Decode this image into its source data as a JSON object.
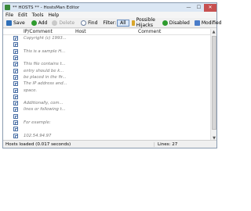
{
  "titlebar": {
    "title": "** HOSTS ** - HostsMan Editor",
    "minimize_glyph": "—",
    "maximize_glyph": "☐",
    "close_glyph": "✕"
  },
  "menubar": {
    "items": [
      "File",
      "Edit",
      "Tools",
      "Help"
    ]
  },
  "toolbar": {
    "save": "Save",
    "add": "Add",
    "delete": "Delete",
    "find": "Find",
    "filter_label": "Filter:",
    "filter_all": "All",
    "possible_hijacks": "Possible Hijacks",
    "disabled": "Disabled",
    "modified": "Modified"
  },
  "grid": {
    "columns": [
      "IP/Comment",
      "Host",
      "Comment"
    ],
    "rows": [
      "Copyright (c) 1993...",
      "",
      "This is a sample H...",
      "",
      "This file contains t...",
      "entry should be k...",
      "be placed in the fir...",
      "The IP address and...",
      "space.",
      "",
      "Additionally, com...",
      "lines or following t...",
      "",
      "For example:",
      "",
      "102.54.94.97"
    ]
  },
  "statusbar": {
    "left": "Hosts loaded (0.017 seconds)",
    "right": "Lines: 27"
  },
  "colors": {
    "save_icon": "#2f6fb8",
    "add_icon": "#2e9b2e",
    "delete_icon": "#c9c9c9",
    "find_icon": "#6b7fa0",
    "hijack_icon": "#d9a62b",
    "disabled_icon": "#2e9b2e",
    "modified_icon": "#4a7cc8"
  },
  "icons": {
    "save": "floppy-icon",
    "add": "plus-icon",
    "delete": "delete-icon",
    "find": "magnifier-icon",
    "possible_hijacks": "warning-icon",
    "disabled": "check-icon",
    "modified": "modified-icon"
  }
}
